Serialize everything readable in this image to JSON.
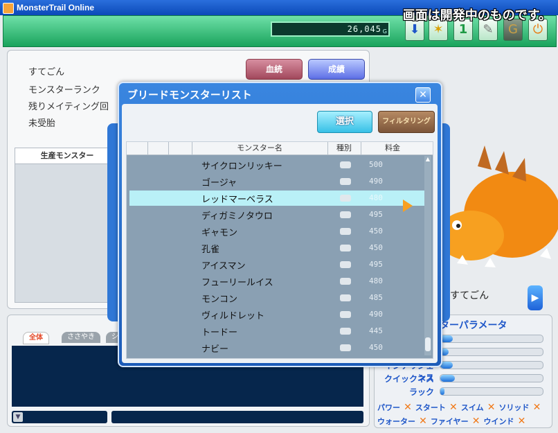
{
  "window": {
    "title": "MonsterTrail Online"
  },
  "topbar": {
    "money": "26,045",
    "money_unit": "G",
    "notice": "画面は開発中のものです。",
    "buttons": [
      "download-icon",
      "running-icon",
      "info-icon",
      "wrench-icon",
      "gold-bag-icon",
      "power-icon"
    ]
  },
  "breeding": {
    "owner": "すてごん",
    "monster_rank_label": "モンスターランク",
    "mating_remaining_label": "残りメイティング回",
    "pregnancy_status": "未受胎",
    "lineage_button": "血統",
    "results_button": "成績",
    "produced_header": "生産モンスター"
  },
  "chat": {
    "tabs": [
      "全体",
      "ささやき",
      "シ"
    ]
  },
  "preview": {
    "monster_name": "すてごん"
  },
  "params": {
    "title": "ターパラメータ",
    "rows": [
      {
        "label": "",
        "value": 0.12
      },
      {
        "label": "",
        "value": 0.08
      },
      {
        "label": "インテリジェンス",
        "value": 0.12
      },
      {
        "label": "クイックネス",
        "value": 0.14
      },
      {
        "label": "ラック",
        "value": 0.04
      }
    ],
    "elements_row1": [
      "パワー",
      "スタート",
      "スイム",
      "ソリッド"
    ],
    "elements_row2": [
      "ウォーター",
      "ファイヤー",
      "ウインド"
    ],
    "x_mark": "✕"
  },
  "dialog": {
    "title": "ブリードモンスターリスト",
    "close": "✕",
    "select_button": "選択",
    "filter_button": "フィルタリング",
    "columns": {
      "name": "モンスター名",
      "type": "種別",
      "fee": "料金"
    },
    "rows": [
      {
        "name": "サイクロンリッキー",
        "fee": "500"
      },
      {
        "name": "ゴージャ",
        "fee": "490"
      },
      {
        "name": "レッドマーベラス",
        "fee": "480",
        "selected": true
      },
      {
        "name": "ディガミノタウロ",
        "fee": "495"
      },
      {
        "name": "ギャモン",
        "fee": "450"
      },
      {
        "name": "孔雀",
        "fee": "450"
      },
      {
        "name": "アイスマン",
        "fee": "495"
      },
      {
        "name": "フューリールイス",
        "fee": "480"
      },
      {
        "name": "モンコン",
        "fee": "485"
      },
      {
        "name": "ヴィルドレット",
        "fee": "490"
      },
      {
        "name": "トードー",
        "fee": "445"
      },
      {
        "name": "ナビー",
        "fee": "450"
      }
    ]
  },
  "colors": {
    "accent": "#1c5bb8",
    "topbar": "#19a35c",
    "highlight": "#b9f0f7"
  }
}
